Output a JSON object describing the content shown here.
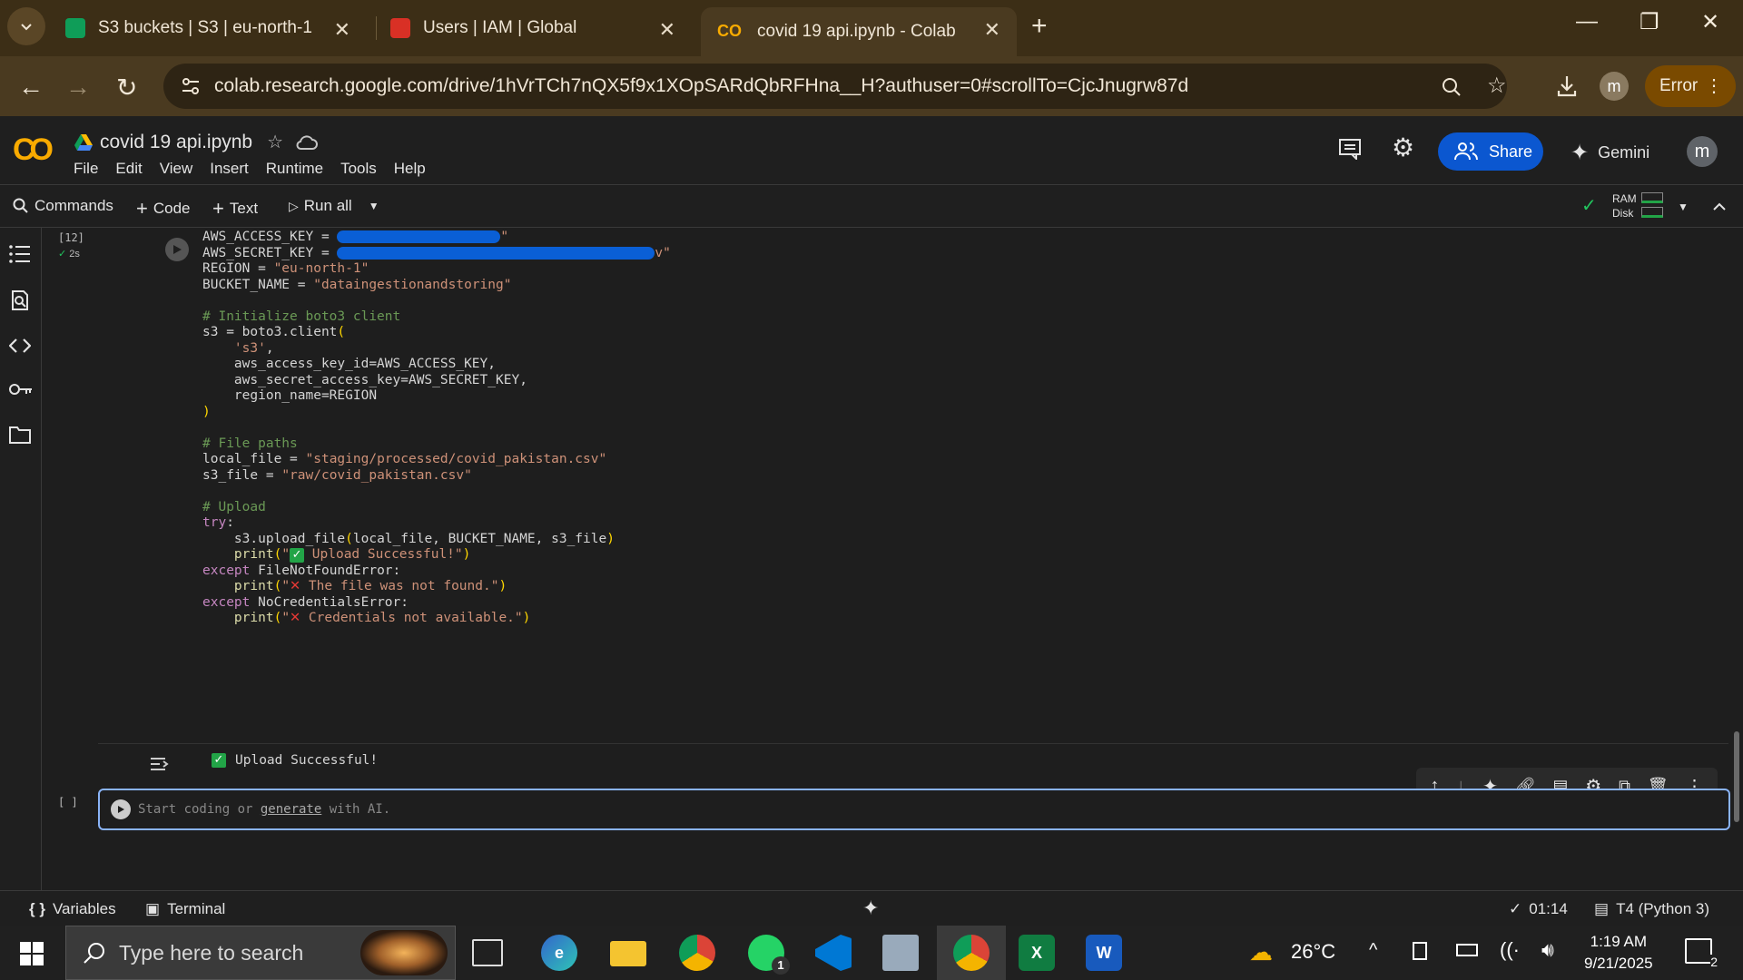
{
  "browser": {
    "tabs": [
      {
        "title": "S3 buckets | S3 | eu-north-1",
        "color": "#0f9d58"
      },
      {
        "title": "Users | IAM | Global",
        "color": "#d93025"
      },
      {
        "title": "covid 19 api.ipynb - Colab",
        "color": "#f9ab00"
      }
    ],
    "url": "colab.research.google.com/drive/1hVrTCh7nQX5f9x1XOpSARdQbRFHna__H?authuser=0#scrollTo=CjcJnugrw87d",
    "profile_initial": "m",
    "error_label": "Error"
  },
  "colab": {
    "logo": "CO",
    "notebook_title": "covid 19 api.ipynb",
    "menu": [
      "File",
      "Edit",
      "View",
      "Insert",
      "Runtime",
      "Tools",
      "Help"
    ],
    "share_label": "Share",
    "gemini_label": "Gemini",
    "account_initial": "m",
    "toolbar": {
      "commands": "Commands",
      "code": "Code",
      "text": "Text",
      "run_all": "Run all",
      "ram": "RAM",
      "disk": "Disk"
    }
  },
  "cell": {
    "exec_count": "[12]",
    "exec_time": "2s",
    "code_lines": [
      {
        "t": "AWS_ACCESS_KEY = ",
        "redact": 180,
        "tail": "\""
      },
      {
        "t": "AWS_SECRET_KEY = ",
        "redact": 350,
        "tail": "v\""
      },
      {
        "h": [
          [
            "",
            "REGION = "
          ],
          [
            "st",
            "\"eu-north-1\""
          ]
        ]
      },
      {
        "h": [
          [
            "",
            "BUCKET_NAME = "
          ],
          [
            "st",
            "\"dataingestionandstoring\""
          ]
        ]
      },
      {
        "h": [
          [
            "",
            ""
          ]
        ]
      },
      {
        "h": [
          [
            "cm",
            "# Initialize boto3 client"
          ]
        ]
      },
      {
        "h": [
          [
            "",
            "s3 = boto3.client"
          ],
          [
            "pa",
            "("
          ]
        ]
      },
      {
        "h": [
          [
            "",
            "    "
          ],
          [
            "st",
            "'s3'"
          ],
          [
            "",
            ","
          ]
        ]
      },
      {
        "h": [
          [
            "",
            "    aws_access_key_id=AWS_ACCESS_KEY,"
          ]
        ]
      },
      {
        "h": [
          [
            "",
            "    aws_secret_access_key=AWS_SECRET_KEY,"
          ]
        ]
      },
      {
        "h": [
          [
            "",
            "    region_name=REGION"
          ]
        ]
      },
      {
        "h": [
          [
            "pa",
            ")"
          ]
        ]
      },
      {
        "h": [
          [
            "",
            ""
          ]
        ]
      },
      {
        "h": [
          [
            "cm",
            "# File paths"
          ]
        ]
      },
      {
        "h": [
          [
            "",
            "local_file = "
          ],
          [
            "st",
            "\"staging/processed/covid_pakistan.csv\""
          ]
        ]
      },
      {
        "h": [
          [
            "",
            "s3_file = "
          ],
          [
            "st",
            "\"raw/covid_pakistan.csv\""
          ]
        ]
      },
      {
        "h": [
          [
            "",
            ""
          ]
        ]
      },
      {
        "h": [
          [
            "cm",
            "# Upload"
          ]
        ]
      },
      {
        "h": [
          [
            "kw",
            "try"
          ],
          [
            "",
            ":"
          ]
        ]
      },
      {
        "h": [
          [
            "",
            "    s3.upload_file"
          ],
          [
            "pa",
            "("
          ],
          [
            "",
            "local_file, BUCKET_NAME, s3_file"
          ],
          [
            "pa",
            ")"
          ]
        ]
      },
      {
        "h": [
          [
            "",
            "    "
          ],
          [
            "fn",
            "print"
          ],
          [
            "pa",
            "("
          ],
          [
            "st",
            "\""
          ],
          [
            "chk",
            "✓"
          ],
          [
            "st",
            " Upload Successful!\""
          ],
          [
            "pa",
            ")"
          ]
        ]
      },
      {
        "h": [
          [
            "kw",
            "except"
          ],
          [
            "",
            " FileNotFoundError:"
          ]
        ]
      },
      {
        "h": [
          [
            "",
            "    "
          ],
          [
            "fn",
            "print"
          ],
          [
            "pa",
            "("
          ],
          [
            "st",
            "\""
          ],
          [
            "x",
            "✕"
          ],
          [
            "st",
            " The file was not found.\""
          ],
          [
            "pa",
            ")"
          ]
        ]
      },
      {
        "h": [
          [
            "kw",
            "except"
          ],
          [
            "",
            " NoCredentialsError:"
          ]
        ]
      },
      {
        "h": [
          [
            "",
            "    "
          ],
          [
            "fn",
            "print"
          ],
          [
            "pa",
            "("
          ],
          [
            "st",
            "\""
          ],
          [
            "x",
            "✕"
          ],
          [
            "st",
            " Credentials not available.\""
          ],
          [
            "pa",
            ")"
          ]
        ]
      }
    ],
    "output_text": "Upload Successful!"
  },
  "next_cell": {
    "exec_count": "[ ]",
    "placeholder_prefix": "Start coding or ",
    "placeholder_link": "generate",
    "placeholder_suffix": " with AI."
  },
  "statusbar": {
    "variables": "Variables",
    "terminal": "Terminal",
    "elapsed": "01:14",
    "runtime": "T4 (Python 3)"
  },
  "taskbar": {
    "search_placeholder": "Type here to search",
    "temperature": "26°C",
    "time": "1:19 AM",
    "date": "9/21/2025",
    "whatsapp_badge": "1",
    "notif_count": "2"
  }
}
